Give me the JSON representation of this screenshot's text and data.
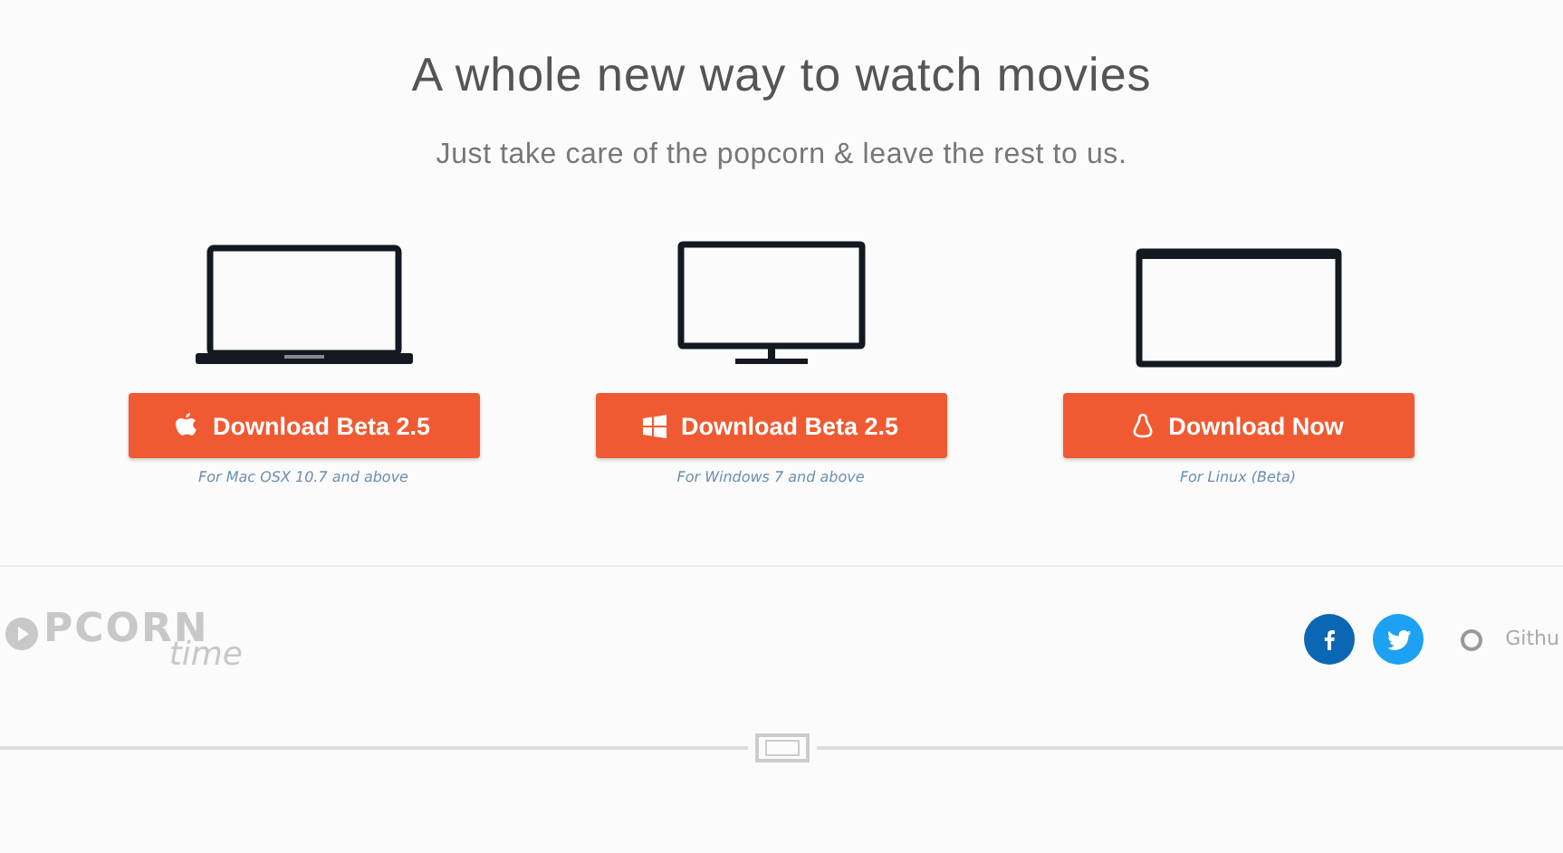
{
  "hero": {
    "title": "A whole new way to watch movies",
    "subtitle": "Just take care of the popcorn & leave the rest to us."
  },
  "downloads": [
    {
      "kind": "mac",
      "button": "Download Beta 2.5",
      "caption": "For Mac OSX 10.7 and above"
    },
    {
      "kind": "windows",
      "button": "Download Beta 2.5",
      "caption": "For Windows 7 and above"
    },
    {
      "kind": "linux",
      "button": "Download Now",
      "caption": "For Linux (Beta)"
    }
  ],
  "footer": {
    "logo": {
      "main": "PCORN",
      "sub": "time"
    },
    "social": [
      {
        "kind": "facebook"
      },
      {
        "kind": "twitter"
      }
    ],
    "github": "Githu"
  }
}
